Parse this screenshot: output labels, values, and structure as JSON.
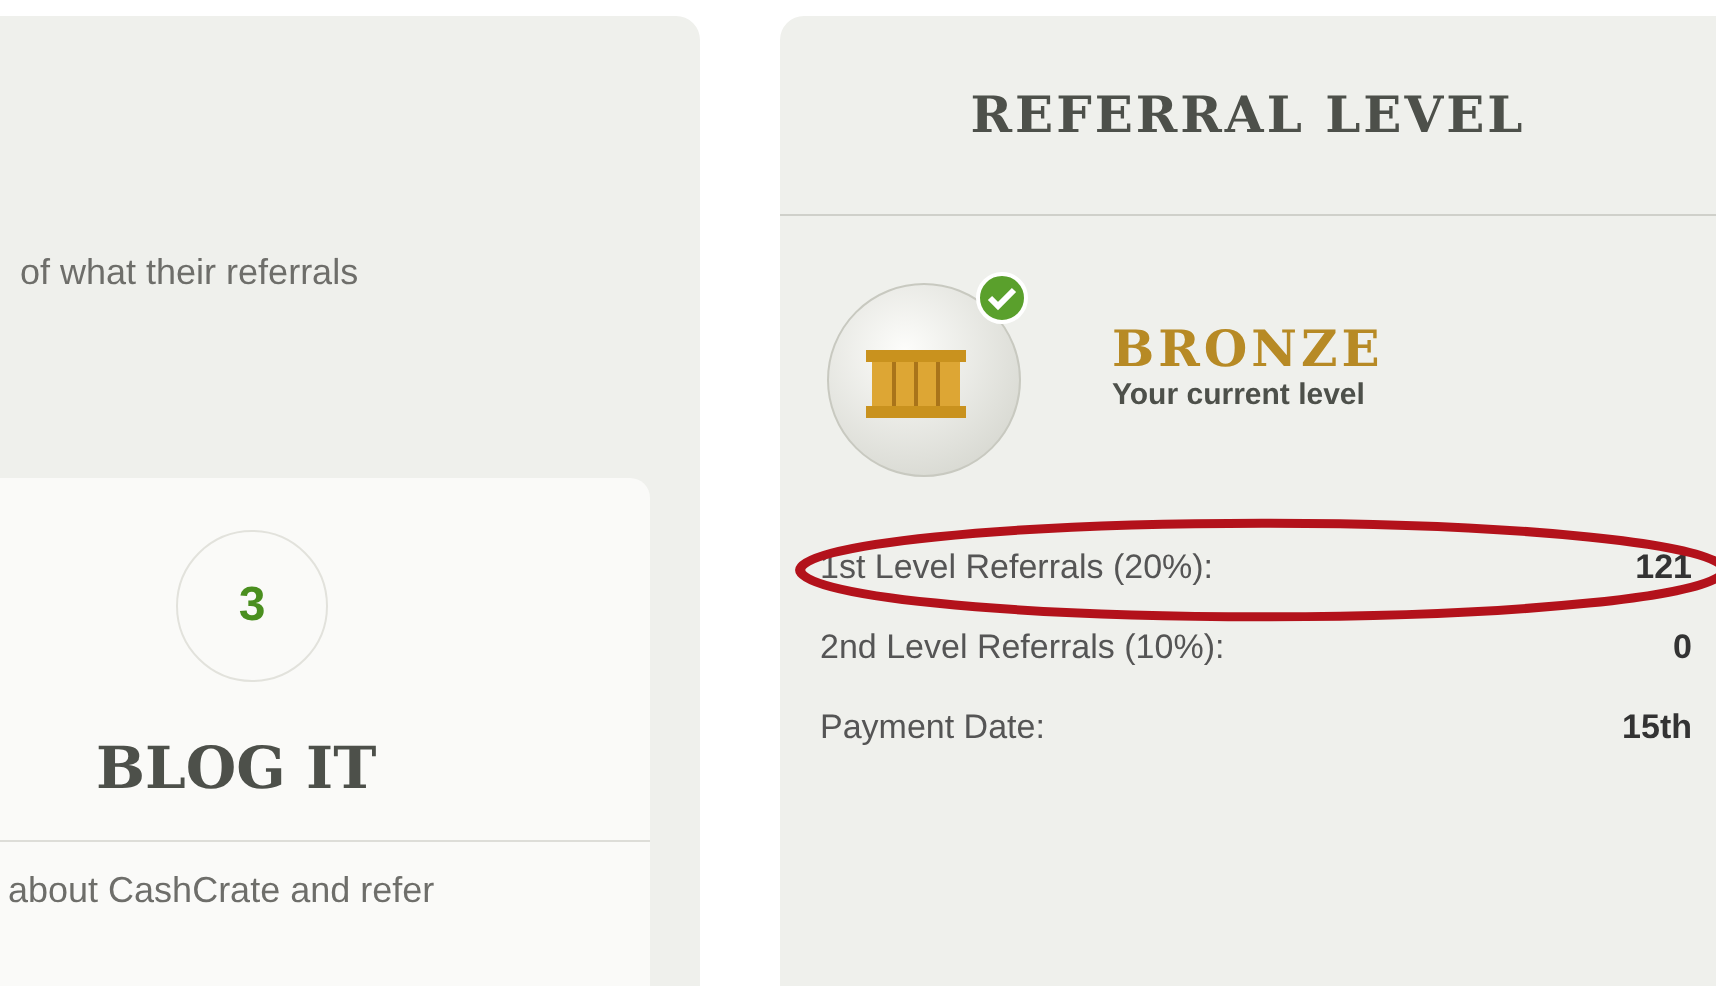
{
  "left_panel": {
    "intro_text": "of what their referrals",
    "step_card": {
      "number": "3",
      "title": "BLOG IT",
      "body_text": "about CashCrate and refer"
    }
  },
  "referral_level": {
    "title": "REFERRAL LEVEL",
    "level_name": "BRONZE",
    "level_caption": "Your current level",
    "achieved": true,
    "rows": [
      {
        "label": "1st Level Referrals (20%):",
        "value": "121",
        "highlighted": true
      },
      {
        "label": "2nd Level Referrals (10%):",
        "value": "0",
        "highlighted": false
      },
      {
        "label": "Payment Date:",
        "value": "15th",
        "highlighted": false
      }
    ]
  }
}
